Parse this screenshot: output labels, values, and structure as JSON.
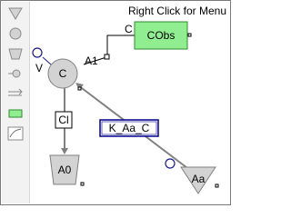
{
  "hint": "Right Click for Menu",
  "palette": [
    {
      "icon": "triangle-down-icon"
    },
    {
      "icon": "circle-icon"
    },
    {
      "icon": "trapezoid-icon"
    },
    {
      "icon": "node-connector-icon"
    },
    {
      "icon": "double-arrow-icon"
    },
    {
      "icon": "green-block-icon"
    },
    {
      "icon": "curve-graph-icon"
    }
  ],
  "nodes": {
    "compartment": "C",
    "observation": "CObs",
    "clearance": "Cl",
    "elimination": "A0",
    "absorption": "Aa",
    "rate_constant": "K_Aa_C"
  },
  "ports": {
    "v_label": "V",
    "a1_label": "A1",
    "c_label": "C"
  },
  "colors": {
    "observation_fill": "#90ee90",
    "node_fill": "#d3d3d3",
    "accent_border": "#00008b"
  }
}
